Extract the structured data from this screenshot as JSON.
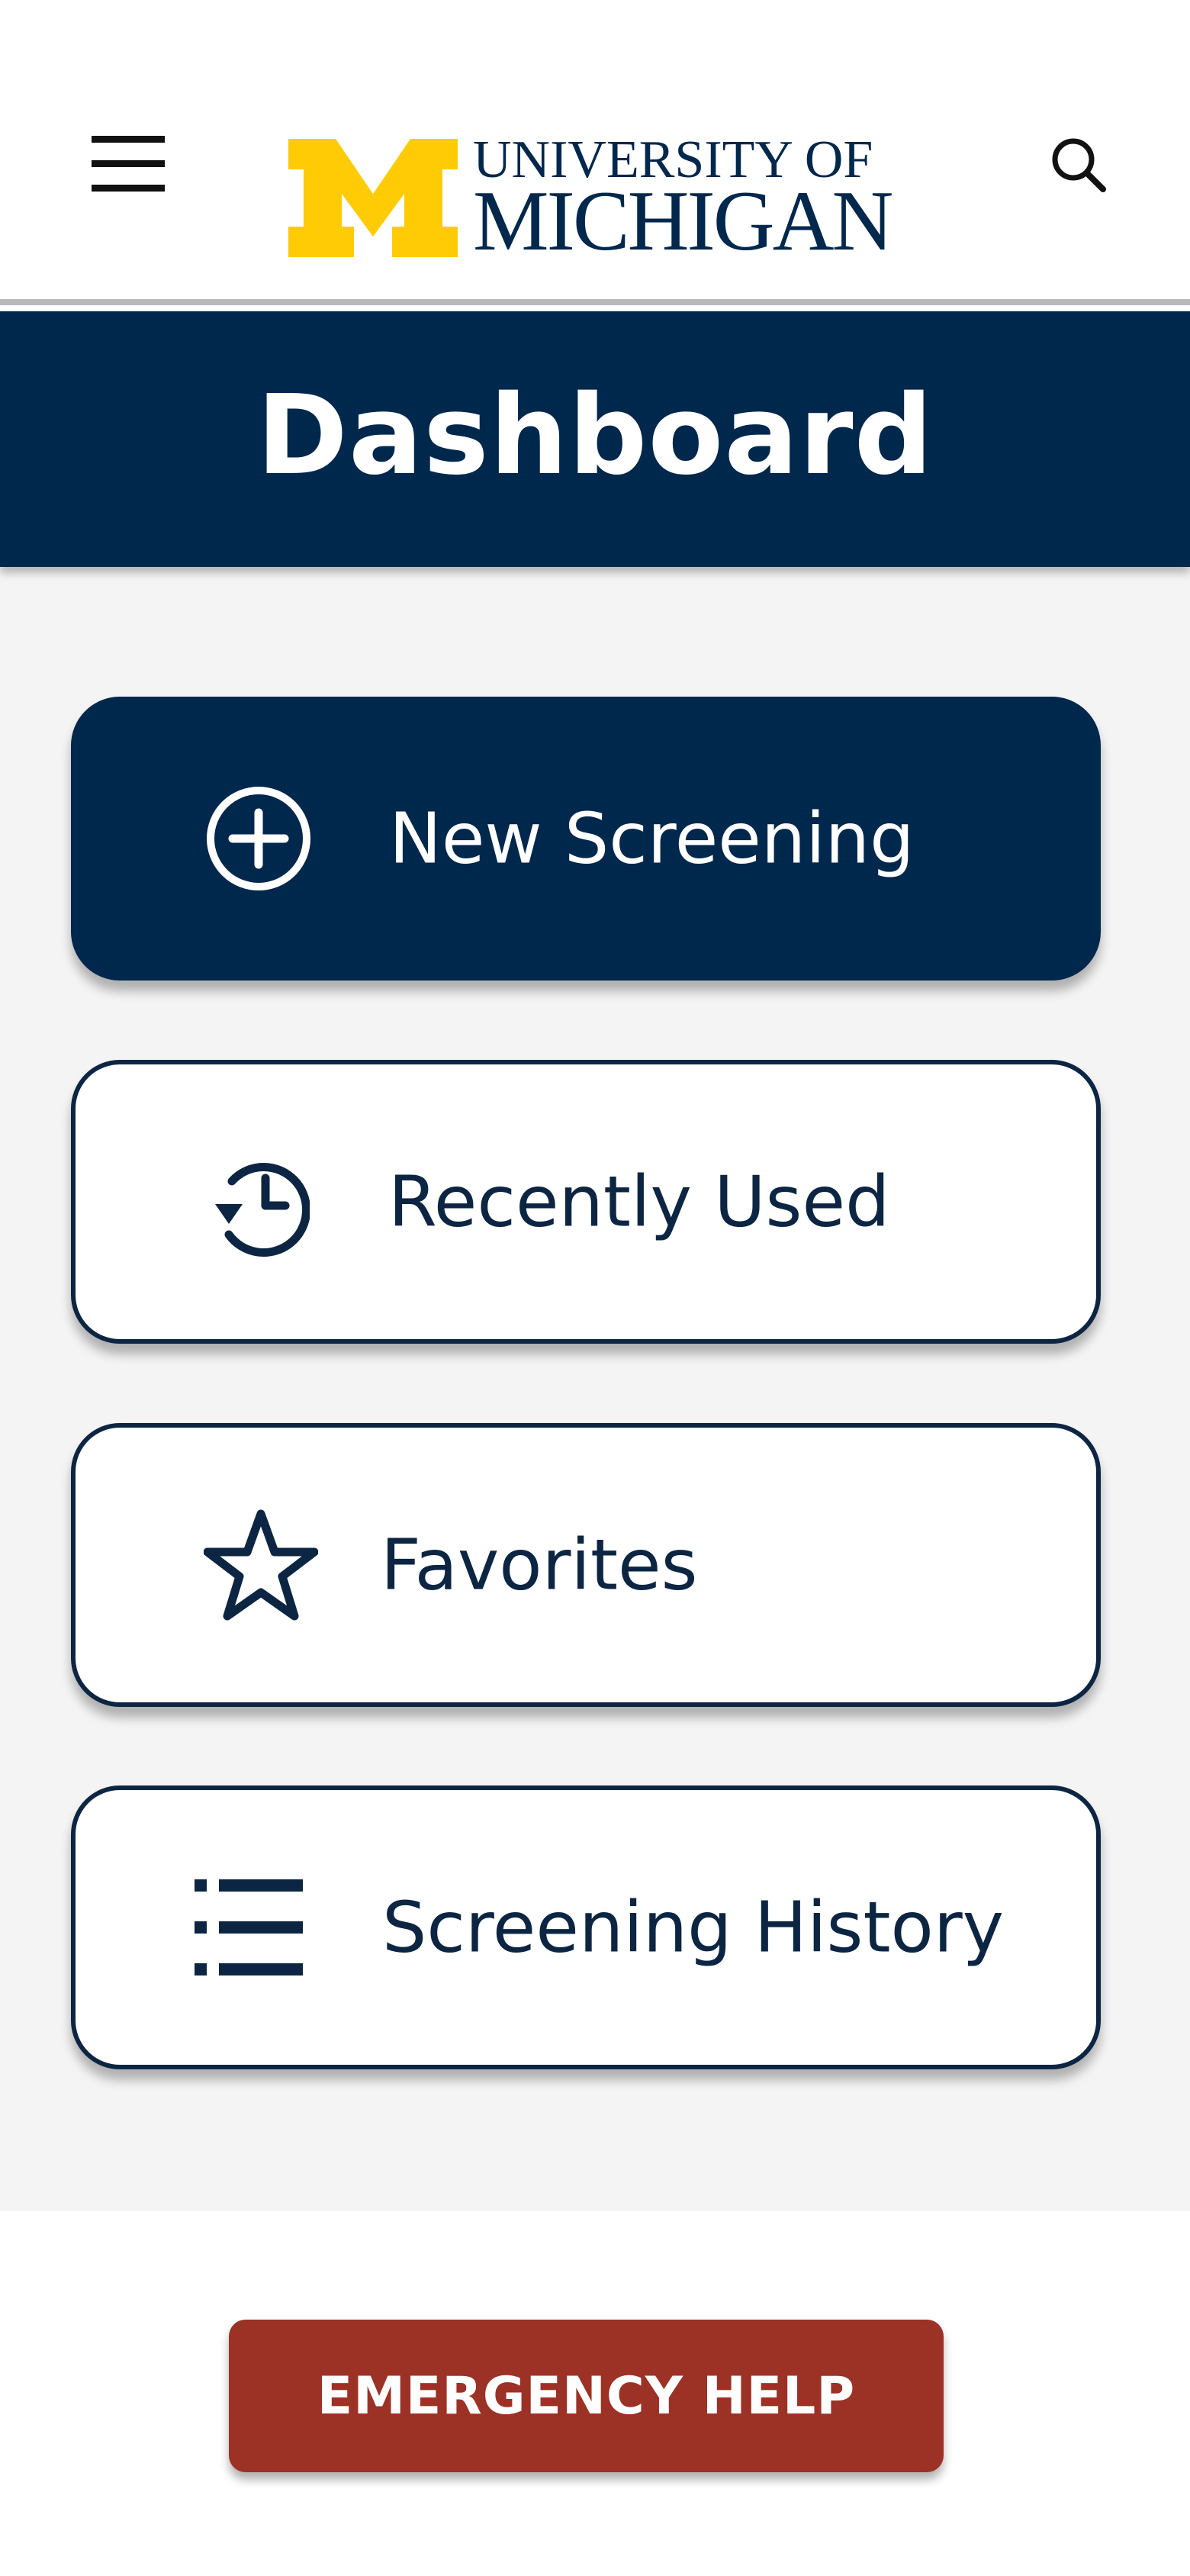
{
  "header": {
    "menu_icon": "hamburger-menu-icon",
    "search_icon": "search-icon",
    "logo": {
      "line1": "UNIVERSITY OF",
      "line2": "MICHIGAN",
      "mark": "M"
    }
  },
  "title": "Dashboard",
  "menu": {
    "items": [
      {
        "label": "New Screening",
        "icon": "plus-circle-icon"
      },
      {
        "label": "Recently Used",
        "icon": "history-icon"
      },
      {
        "label": "Favorites",
        "icon": "star-icon"
      },
      {
        "label": "Screening History",
        "icon": "list-icon"
      }
    ]
  },
  "footer": {
    "emergency_label": "EMERGENCY HELP"
  },
  "colors": {
    "navy": "#00274c",
    "maize": "#ffcb05",
    "emergency_red": "#9c3125",
    "background": "#f4f4f5"
  }
}
